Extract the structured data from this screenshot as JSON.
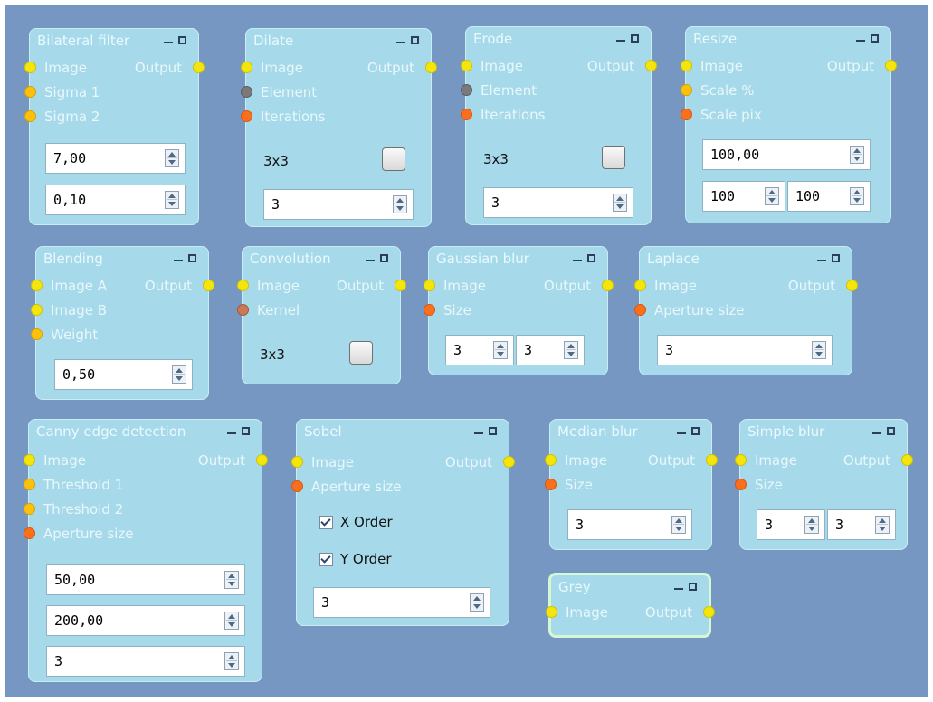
{
  "nodes": {
    "bilateral": {
      "title": "Bilateral filter",
      "image": "Image",
      "output": "Output",
      "sigma1": "Sigma 1",
      "sigma2": "Sigma 2",
      "f1": "7,00",
      "f2": "0,10"
    },
    "dilate": {
      "title": "Dilate",
      "image": "Image",
      "output": "Output",
      "element": "Element",
      "iterations": "Iterations",
      "kernel": "3x3",
      "f1": "3"
    },
    "erode": {
      "title": "Erode",
      "image": "Image",
      "output": "Output",
      "element": "Element",
      "iterations": "Iterations",
      "kernel": "3x3",
      "f1": "3"
    },
    "resize": {
      "title": "Resize",
      "image": "Image",
      "output": "Output",
      "scale_pct": "Scale %",
      "scale_pix": "Scale pix",
      "f1": "100,00",
      "w": "100",
      "h": "100"
    },
    "blending": {
      "title": "Blending",
      "image_a": "Image A",
      "output": "Output",
      "image_b": "Image B",
      "weight": "Weight",
      "f1": "0,50"
    },
    "convolution": {
      "title": "Convolution",
      "image": "Image",
      "output": "Output",
      "kernel": "Kernel",
      "kernel_size": "3x3"
    },
    "gaussian": {
      "title": "Gaussian blur",
      "image": "Image",
      "output": "Output",
      "size": "Size",
      "w": "3",
      "h": "3"
    },
    "laplace": {
      "title": "Laplace",
      "image": "Image",
      "output": "Output",
      "aperture": "Aperture size",
      "f1": "3"
    },
    "canny": {
      "title": "Canny edge detection",
      "image": "Image",
      "output": "Output",
      "t1": "Threshold 1",
      "t2": "Threshold 2",
      "aperture": "Aperture size",
      "f1": "50,00",
      "f2": "200,00",
      "f3": "3"
    },
    "sobel": {
      "title": "Sobel",
      "image": "Image",
      "output": "Output",
      "aperture": "Aperture size",
      "xorder": "X Order",
      "yorder": "Y Order",
      "f1": "3"
    },
    "median": {
      "title": "Median blur",
      "image": "Image",
      "output": "Output",
      "size": "Size",
      "f1": "3"
    },
    "simple": {
      "title": "Simple blur",
      "image": "Image",
      "output": "Output",
      "size": "Size",
      "w": "3",
      "h": "3"
    },
    "grey": {
      "title": "Grey",
      "image": "Image",
      "output": "Output"
    }
  },
  "colors": {
    "canvas": "#7597c2",
    "node": "#a6daea",
    "selected_border": "#d5f7d2",
    "port_yellow": "#f4e60c",
    "port_orange": "#fa6f1c",
    "port_gold": "#fbc10d",
    "port_gray": "#7a7a7a",
    "port_brown": "#c77a55"
  }
}
